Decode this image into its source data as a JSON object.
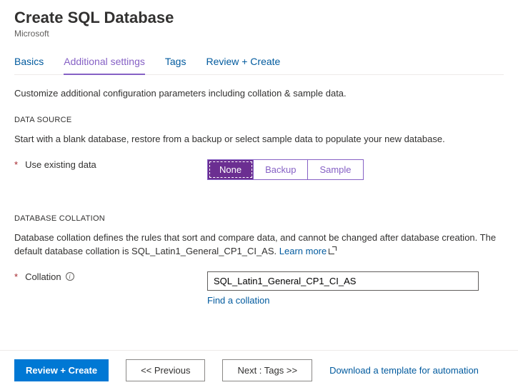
{
  "header": {
    "title": "Create SQL Database",
    "publisher": "Microsoft"
  },
  "tabs": [
    {
      "label": "Basics",
      "active": false
    },
    {
      "label": "Additional settings",
      "active": true
    },
    {
      "label": "Tags",
      "active": false
    },
    {
      "label": "Review + Create",
      "active": false
    }
  ],
  "intro": "Customize additional configuration parameters including collation & sample data.",
  "data_source": {
    "heading": "DATA SOURCE",
    "desc": "Start with a blank database, restore from a backup or select sample data to populate your new database.",
    "field_label": "Use existing data",
    "options": [
      {
        "label": "None",
        "selected": true
      },
      {
        "label": "Backup",
        "selected": false
      },
      {
        "label": "Sample",
        "selected": false
      }
    ]
  },
  "collation": {
    "heading": "DATABASE COLLATION",
    "desc_prefix": "Database collation defines the rules that sort and compare data, and cannot be changed after database creation. The default database collation is SQL_Latin1_General_CP1_CI_AS. ",
    "learn_more": "Learn more",
    "field_label": "Collation",
    "value": "SQL_Latin1_General_CP1_CI_AS",
    "find_link": "Find a collation"
  },
  "footer": {
    "review": "Review + Create",
    "previous": "<< Previous",
    "next": "Next : Tags >>",
    "download": "Download a template for automation"
  }
}
